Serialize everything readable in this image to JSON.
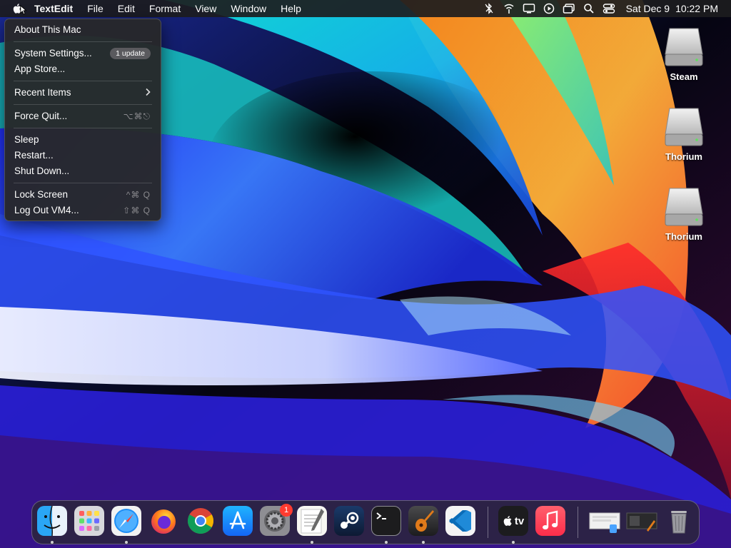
{
  "menubar": {
    "app_name": "TextEdit",
    "menus": [
      "File",
      "Edit",
      "Format",
      "View",
      "Window",
      "Help"
    ],
    "date": "Sat Dec 9",
    "time": "10:22 PM",
    "status_icons": [
      "bluetooth-icon",
      "wifi-icon",
      "display-icon",
      "screen-record-icon",
      "window-switch-icon",
      "search-icon",
      "control-center-icon"
    ]
  },
  "apple_menu": {
    "about": "About This Mac",
    "system_settings": "System Settings...",
    "update_badge": "1 update",
    "app_store": "App Store...",
    "recent_items": "Recent Items",
    "force_quit": "Force Quit...",
    "force_quit_shortcut": "⌥⌘⎋",
    "sleep": "Sleep",
    "restart": "Restart...",
    "shut_down": "Shut Down...",
    "lock_screen": "Lock Screen",
    "lock_screen_shortcut": "^⌘ Q",
    "log_out": "Log Out VM4...",
    "log_out_shortcut": "⇧⌘ Q"
  },
  "desktop": {
    "icons": [
      {
        "label": "Steam"
      },
      {
        "label": "Thorium"
      },
      {
        "label": "Thorium"
      }
    ]
  },
  "dock": {
    "apps": [
      "finder",
      "launchpad",
      "safari",
      "firefox",
      "chrome",
      "app-store",
      "system-settings",
      "textedit",
      "steam",
      "terminal",
      "garageband",
      "vscode",
      "apple-tv",
      "music",
      "downloads-stack",
      "documents-stack",
      "trash"
    ],
    "system_settings_badge": "1",
    "tv_label": "tv"
  },
  "colors": {
    "menubar_bg": "#1c1c1e",
    "menu_bg": "#28282a",
    "badge_bg": "#5a5a5e",
    "notification_red": "#ff3b30"
  }
}
